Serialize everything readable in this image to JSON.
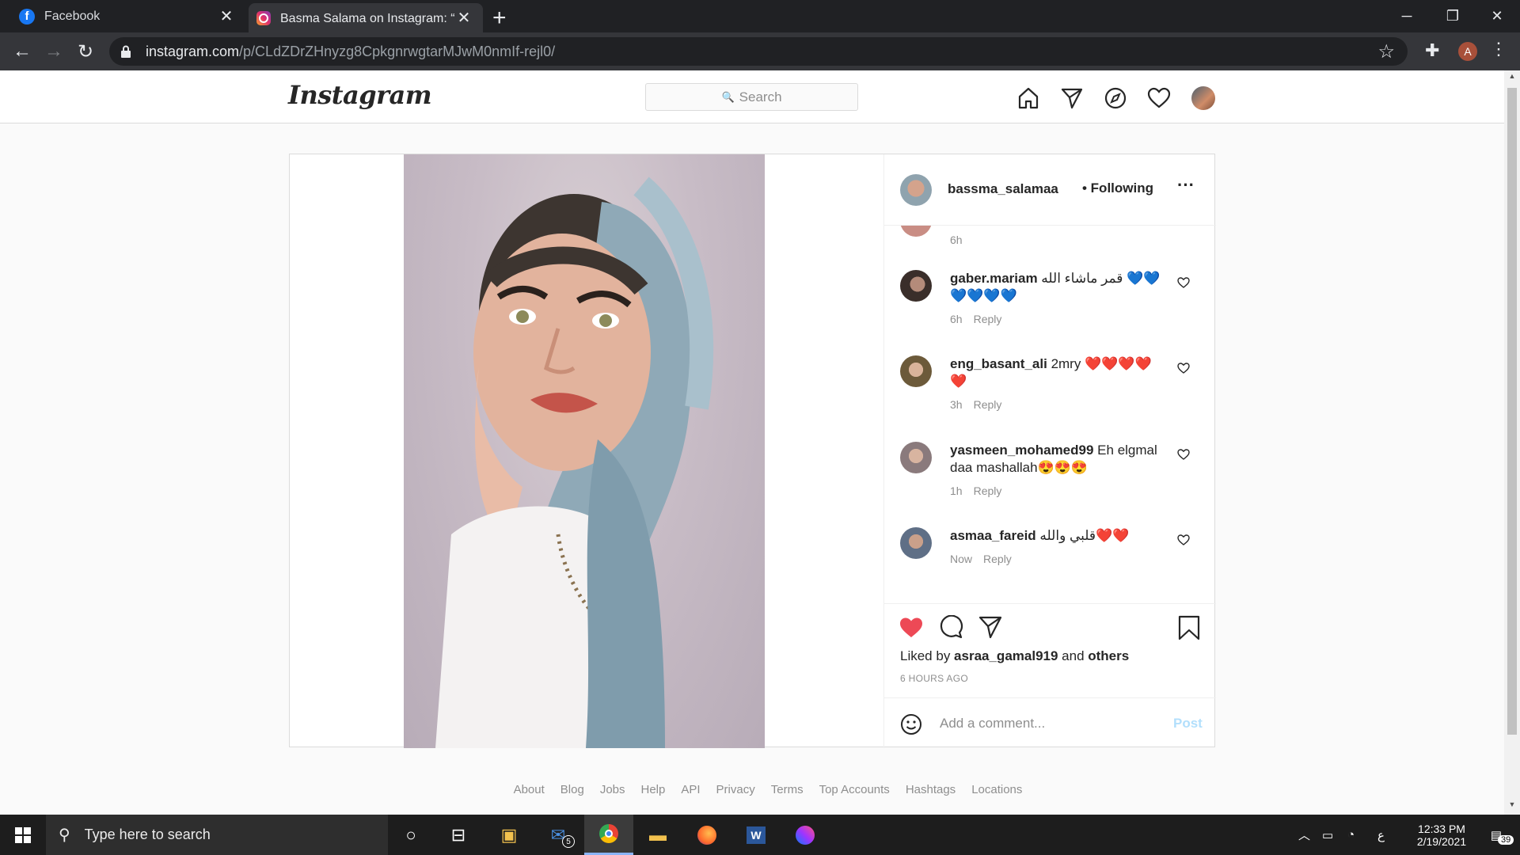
{
  "browser": {
    "tabs": [
      {
        "title": "Facebook",
        "favicon": "facebook-icon",
        "active": false
      },
      {
        "title": "Basma Salama on Instagram: “❄️",
        "favicon": "instagram-icon",
        "active": true
      }
    ],
    "url_host": "instagram.com",
    "url_path": "/p/CLdZDrZHnyzg8CpkgnrwgtarMJwM0nmIf-rejl0/",
    "profile_letter": "A"
  },
  "instagram": {
    "logo": "Instagram",
    "search_placeholder": "Search",
    "post": {
      "author": "bassma_salamaa",
      "follow_status": "• Following",
      "top_time": "6h",
      "comments": [
        {
          "user": "gaber.mariam",
          "text": "قمر ماشاء الله 💙💙💙💙💙💙",
          "time": "6h",
          "reply": "Reply"
        },
        {
          "user": "eng_basant_ali",
          "text": "2mry ❤️❤️❤️❤️❤️",
          "time": "3h",
          "reply": "Reply"
        },
        {
          "user": "yasmeen_mohamed99",
          "text": "Eh elgmal daa mashallah😍😍😍",
          "time": "1h",
          "reply": "Reply"
        },
        {
          "user": "asmaa_fareid",
          "text": "قلبي والله❤️❤️",
          "time": "Now",
          "reply": "Reply"
        }
      ],
      "liked_by_prefix": "Liked by ",
      "liked_by_user": "asraa_gamal919",
      "liked_by_and": " and ",
      "liked_by_others": "others",
      "posted_ago": "6 HOURS AGO",
      "comment_placeholder": "Add a comment...",
      "post_button": "Post"
    },
    "footer": [
      "About",
      "Blog",
      "Jobs",
      "Help",
      "API",
      "Privacy",
      "Terms",
      "Top Accounts",
      "Hashtags",
      "Locations"
    ]
  },
  "taskbar": {
    "search_placeholder": "Type here to search",
    "mail_badge": "5",
    "lang": "ع",
    "time": "12:33 PM",
    "date": "2/19/2021",
    "notification_count": "39"
  },
  "colors": {
    "like_red": "#ed4956",
    "post_blue": "#b2dffc",
    "chrome_dark": "#202124",
    "chrome_tab": "#35363a"
  }
}
